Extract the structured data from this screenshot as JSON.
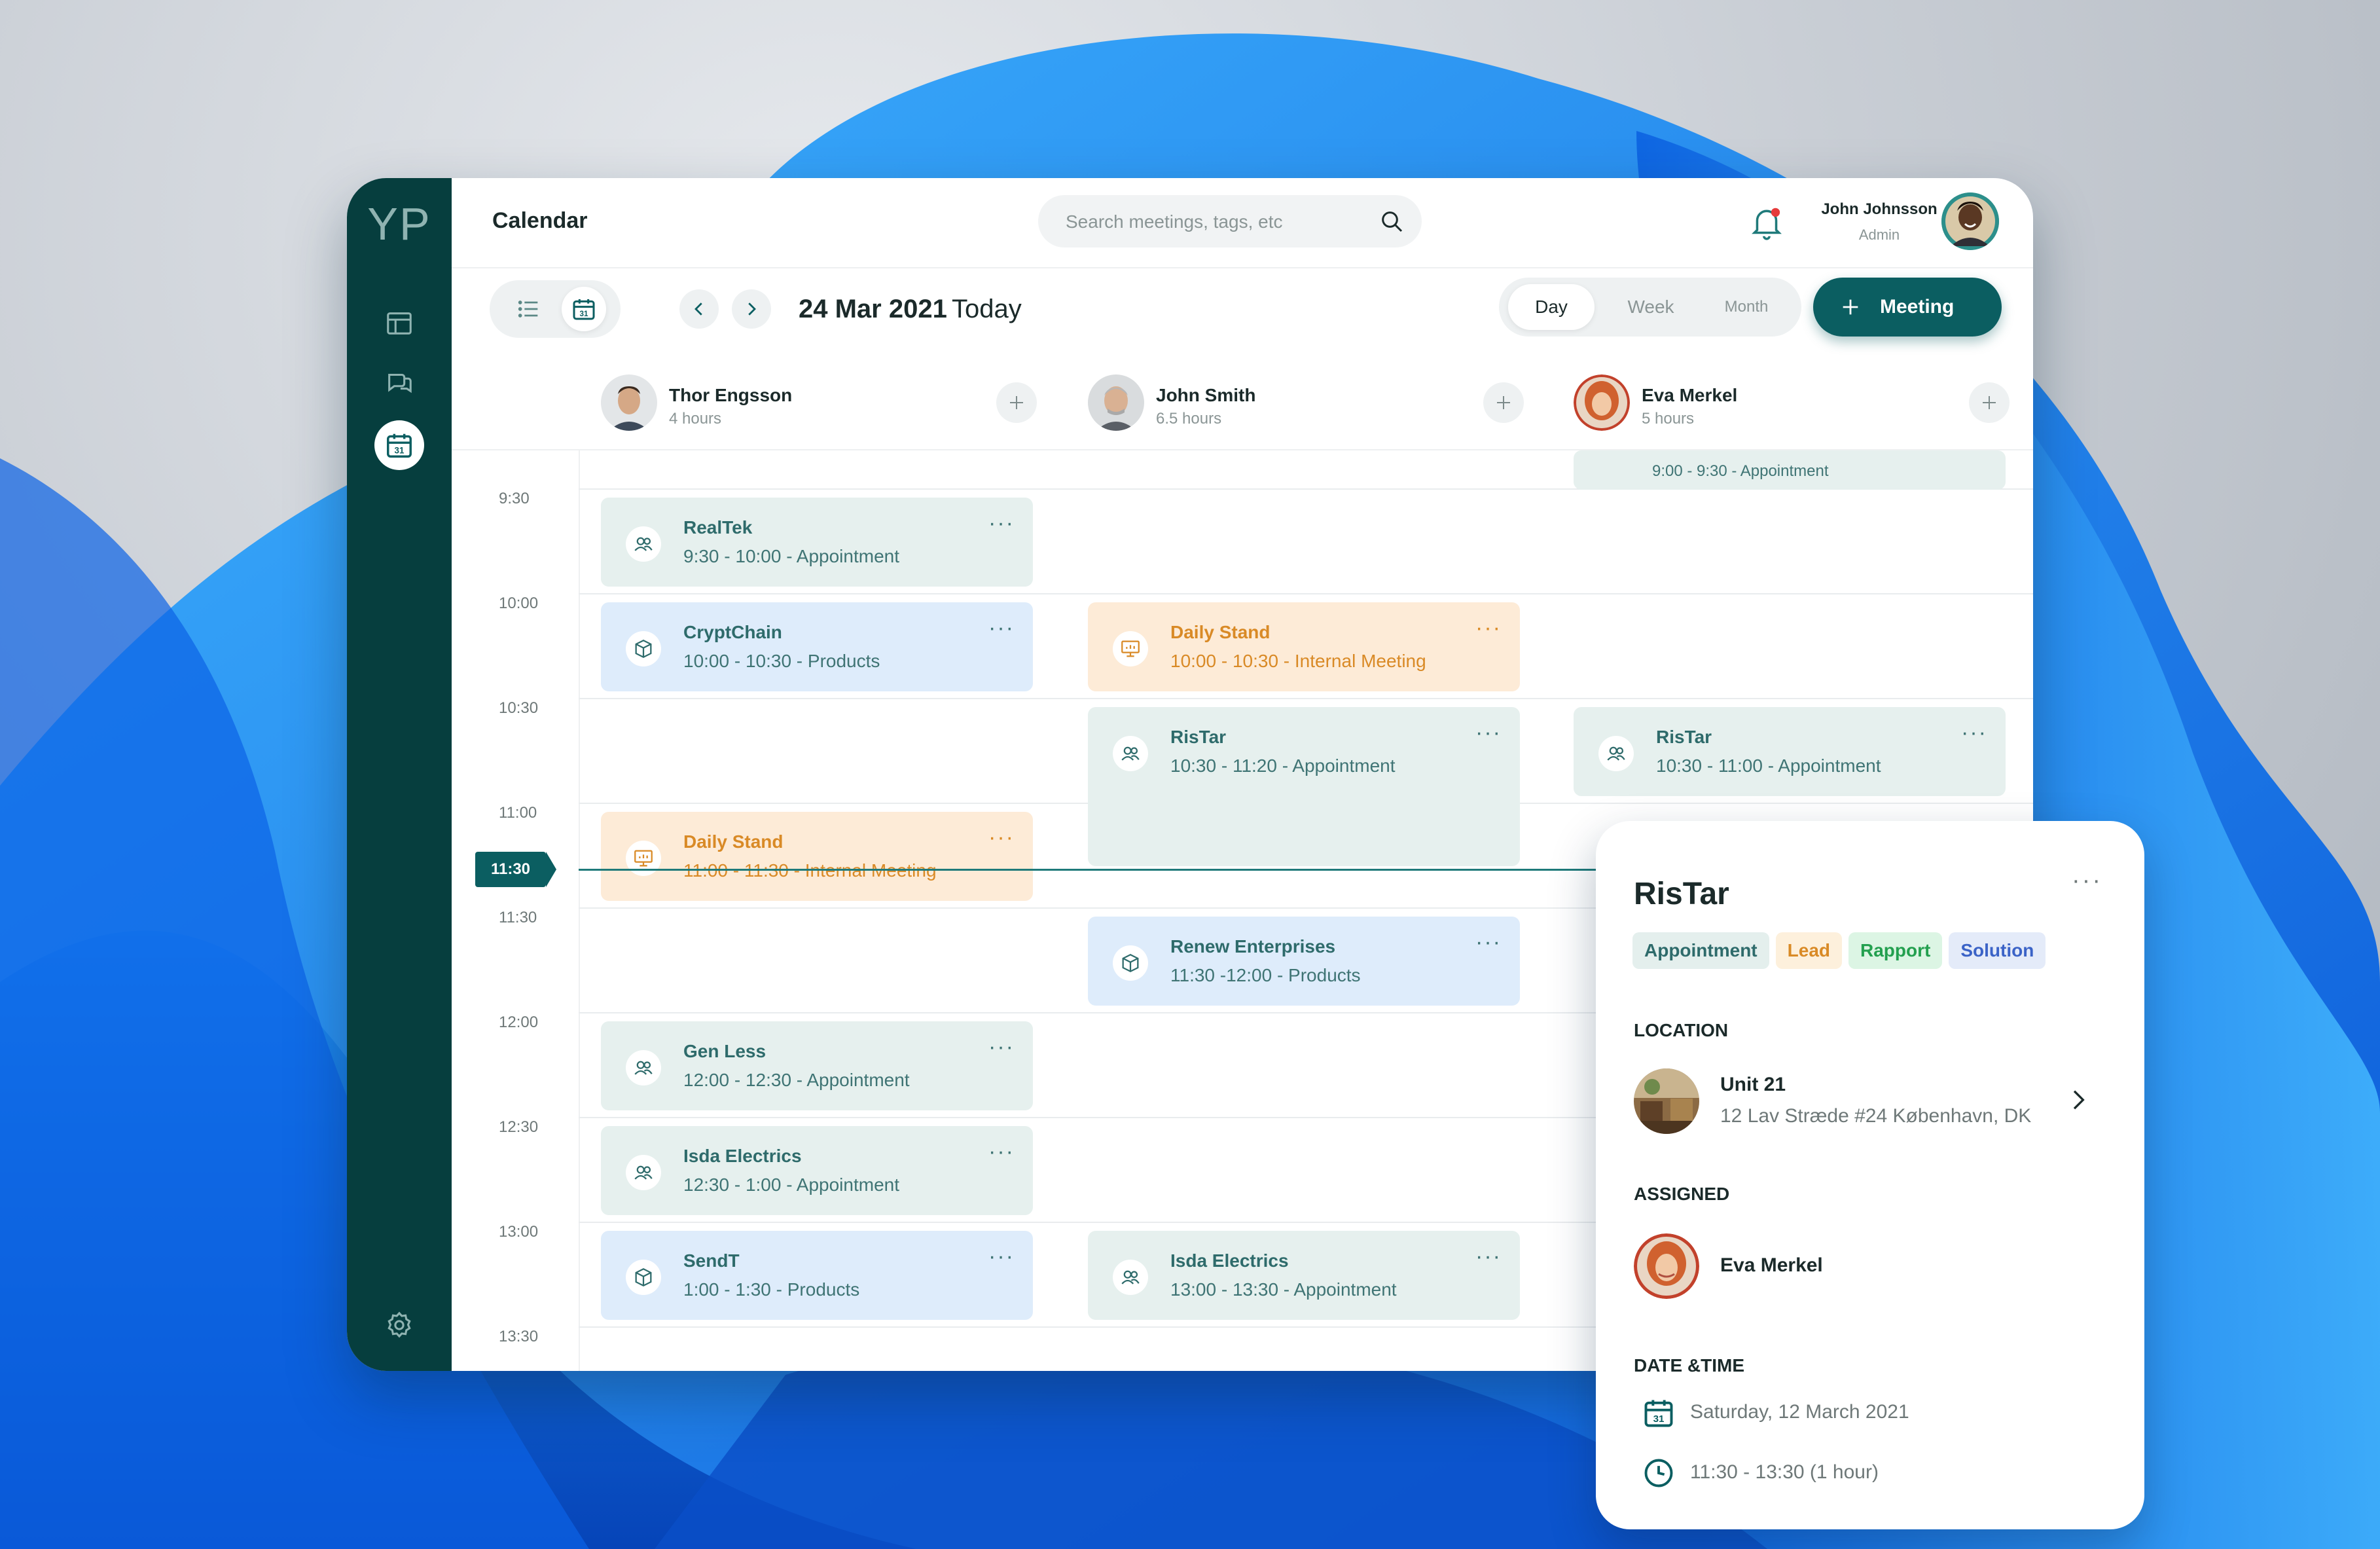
{
  "app": {
    "logo": "YP",
    "title": "Calendar",
    "accent_color": "#0b5e61",
    "sidebar_color": "#063e3e"
  },
  "sidebar": {
    "items": [
      {
        "icon": "layout-icon"
      },
      {
        "icon": "chat-icon"
      },
      {
        "icon": "calendar-icon",
        "active": true
      },
      {
        "icon": "settings-icon"
      }
    ]
  },
  "header": {
    "search_placeholder": "Search meetings, tags, etc",
    "user_name": "John Johnsson",
    "user_role": "Admin"
  },
  "toolbar": {
    "date": "24 Mar 2021",
    "today": "Today",
    "ranges": [
      "Day",
      "Week",
      "Month"
    ],
    "selected_range": "Day",
    "meeting_button": "Meeting"
  },
  "people": [
    {
      "name": "Thor Engsson",
      "hours": "4 hours"
    },
    {
      "name": "John Smith",
      "hours": "6.5 hours"
    },
    {
      "name": "Eva Merkel",
      "hours": "5 hours"
    }
  ],
  "times": [
    "9:30",
    "10:00",
    "10:30",
    "11:00",
    "11:30",
    "12:00",
    "12:30",
    "13:00",
    "13:30"
  ],
  "current_time": "11:30",
  "events": [
    {
      "column": 0,
      "title": "RealTek",
      "subtitle": "9:30 - 10:00 - Appointment",
      "kind": "appointment"
    },
    {
      "column": 0,
      "title": "CryptChain",
      "subtitle": "10:00 - 10:30 - Products",
      "kind": "products"
    },
    {
      "column": 0,
      "title": "Daily Stand",
      "subtitle": "11:00 - 11:30 - Internal Meeting",
      "kind": "internal"
    },
    {
      "column": 0,
      "title": "Gen Less",
      "subtitle": "12:00 - 12:30 - Appointment",
      "kind": "appointment"
    },
    {
      "column": 0,
      "title": "Isda Electrics",
      "subtitle": "12:30 - 1:00 - Appointment",
      "kind": "appointment"
    },
    {
      "column": 0,
      "title": "SendT",
      "subtitle": "1:00 - 1:30 - Products",
      "kind": "products"
    },
    {
      "column": 1,
      "title": "Daily Stand",
      "subtitle": "10:00 - 10:30 - Internal Meeting",
      "kind": "internal"
    },
    {
      "column": 1,
      "title": "RisTar",
      "subtitle": "10:30 - 11:20 - Appointment",
      "kind": "appointment"
    },
    {
      "column": 1,
      "title": "Renew Enterprises",
      "subtitle": "11:30 -12:00 - Products",
      "kind": "products"
    },
    {
      "column": 1,
      "title": "Isda Electrics",
      "subtitle": "13:00 - 13:30 - Appointment",
      "kind": "appointment"
    },
    {
      "column": 2,
      "title": "",
      "subtitle": "9:00 - 9:30 - Appointment",
      "kind": "appointment"
    },
    {
      "column": 2,
      "title": "RisTar",
      "subtitle": "10:30 - 11:00 - Appointment",
      "kind": "appointment"
    }
  ],
  "detail": {
    "title": "RisTar",
    "tags": [
      {
        "label": "Appointment",
        "bg": "#e4efed",
        "fg": "#2e6b6b"
      },
      {
        "label": "Lead",
        "bg": "#fdf0dc",
        "fg": "#d98a26"
      },
      {
        "label": "Rapport",
        "bg": "#dcf5e4",
        "fg": "#23a04f"
      },
      {
        "label": "Solution",
        "bg": "#e4ebf9",
        "fg": "#3b63c7"
      }
    ],
    "location_heading": "LOCATION",
    "location_name": "Unit 21",
    "location_address": "12 Lav Stræde  #24 København, DK",
    "assigned_heading": "ASSIGNED",
    "assigned_name": "Eva Merkel",
    "datetime_heading": "DATE &TIME",
    "date": "Saturday, 12 March 2021",
    "time": "11:30 - 13:30 (1 hour)"
  }
}
